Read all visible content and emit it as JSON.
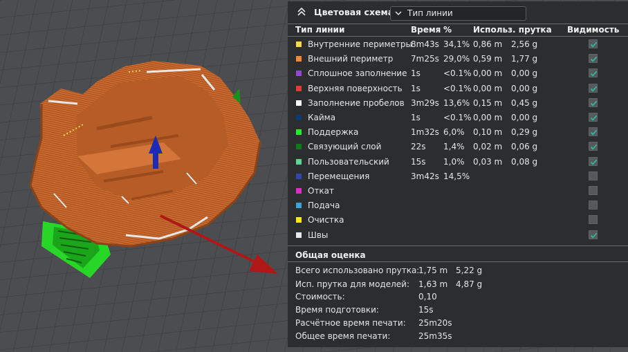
{
  "header": {
    "title": "Цветовая схема",
    "dropdown_value": "Тип линии"
  },
  "columns": {
    "type": "Тип линии",
    "time": "Время",
    "percent": "%",
    "usage": "Использ. прутка",
    "visibility": "Видимость"
  },
  "rows": [
    {
      "name": "Внутренние периметры",
      "color": "#f5d94a",
      "time": "8m43s",
      "pct": "34,1%",
      "m": "0,86 m",
      "g": "2,56 g",
      "visible": true
    },
    {
      "name": "Внешний периметр",
      "color": "#f08a3a",
      "time": "7m25s",
      "pct": "29,0%",
      "m": "0,59 m",
      "g": "1,77 g",
      "visible": true
    },
    {
      "name": "Сплошное заполнение",
      "color": "#8f4ad0",
      "time": "1s",
      "pct": "<0.1%",
      "m": "0,00 m",
      "g": "0,00 g",
      "visible": true
    },
    {
      "name": "Верхняя поверхность",
      "color": "#e03c3c",
      "time": "1s",
      "pct": "<0.1%",
      "m": "0,00 m",
      "g": "0,00 g",
      "visible": true
    },
    {
      "name": "Заполнение пробелов",
      "color": "#ffffff",
      "time": "3m29s",
      "pct": "13,6%",
      "m": "0,15 m",
      "g": "0,45 g",
      "visible": true
    },
    {
      "name": "Кайма",
      "color": "#0d3a6e",
      "time": "1s",
      "pct": "<0.1%",
      "m": "0,00 m",
      "g": "0,00 g",
      "visible": true
    },
    {
      "name": "Поддержка",
      "color": "#2ee82e",
      "time": "1m32s",
      "pct": "6,0%",
      "m": "0,10 m",
      "g": "0,29 g",
      "visible": true
    },
    {
      "name": "Связующий слой",
      "color": "#0f7a1a",
      "time": "22s",
      "pct": "1,4%",
      "m": "0,02 m",
      "g": "0,06 g",
      "visible": true
    },
    {
      "name": "Пользовательский",
      "color": "#5ed68e",
      "time": "15s",
      "pct": "1,0%",
      "m": "0,03 m",
      "g": "0,08 g",
      "visible": true
    },
    {
      "name": "Перемещения",
      "color": "#3446a8",
      "time": "3m42s",
      "pct": "14,5%",
      "m": "",
      "g": "",
      "visible": false
    },
    {
      "name": "Откат",
      "color": "#d92fc2",
      "time": "",
      "pct": "",
      "m": "",
      "g": "",
      "visible": false
    },
    {
      "name": "Подача",
      "color": "#3fa3d6",
      "time": "",
      "pct": "",
      "m": "",
      "g": "",
      "visible": false
    },
    {
      "name": "Очистка",
      "color": "#ffe81c",
      "time": "",
      "pct": "",
      "m": "",
      "g": "",
      "visible": false
    },
    {
      "name": "Швы",
      "color": "#e8e8e8",
      "time": "",
      "pct": "",
      "m": "",
      "g": "",
      "visible": true
    }
  ],
  "summary": {
    "title": "Общая оценка",
    "total_label": "Всего использовано прутка:",
    "total_m": "1,75 m",
    "total_g": "5,22 g",
    "models_label": "Исп. прутка для моделей:",
    "models_m": "1,63 m",
    "models_g": "4,87 g",
    "cost_label": "Стоимость:",
    "cost_value": "0,10",
    "prep_label": "Время подготовки:",
    "prep_value": "15s",
    "est_label": "Расчётное время печати:",
    "est_value": "25m20s",
    "total_time_label": "Общее время печати:",
    "total_time_value": "25m35s"
  }
}
